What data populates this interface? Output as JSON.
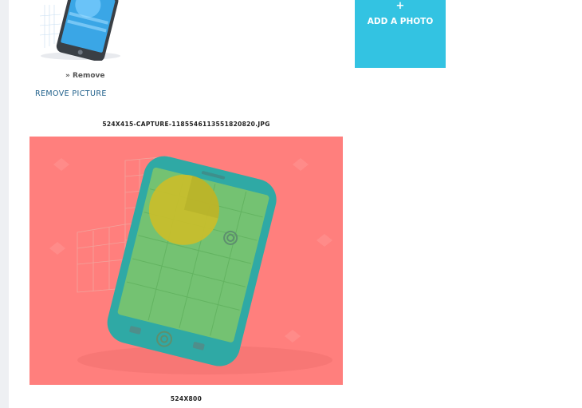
{
  "picture": {
    "remove_label": "» Remove",
    "remove_picture_label": "REMOVE PICTURE"
  },
  "captions": {
    "filename": "524X415-CAPTURE-1185546113551820820.JPG",
    "size": "524X800"
  },
  "add_photo": {
    "plus": "+",
    "label": "ADD A PHOTO"
  },
  "colors": {
    "accent": "#33c3e2",
    "image_overlay": "#ff7f7d",
    "link": "#1e5f8a",
    "gutter": "#eef0f3"
  }
}
